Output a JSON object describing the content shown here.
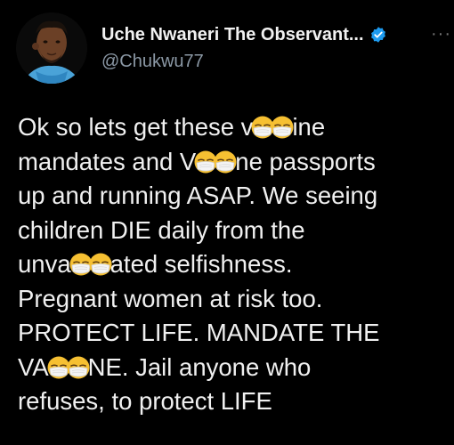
{
  "tweet_header": {
    "display_name": "Uche Nwaneri The Observant...",
    "handle": "@Chukwu77",
    "more_label": "···",
    "verified_icon": "verified-badge-icon",
    "colors": {
      "verified": "#1d9bf0",
      "avatar_ring": "#4aa3d8"
    }
  },
  "tweet_body": {
    "lines": [
      {
        "segments": [
          "Ok so lets get these v",
          "ine"
        ],
        "emojis": [
          "face-with-medical-mask-icon",
          "face-with-medical-mask-icon"
        ]
      },
      {
        "segments": [
          "mandates and V",
          "ne passports"
        ],
        "emojis": [
          "face-with-medical-mask-icon",
          "face-with-medical-mask-icon"
        ]
      },
      {
        "text": "up and running ASAP. We seeing"
      },
      {
        "text": "children DIE daily from the"
      },
      {
        "segments": [
          "unva",
          "ated selfishness."
        ],
        "emojis": [
          "face-with-medical-mask-icon",
          "face-with-medical-mask-icon"
        ]
      },
      {
        "text": "Pregnant women at risk too."
      },
      {
        "text": "PROTECT LIFE. MANDATE THE"
      },
      {
        "segments": [
          "VA",
          "NE. Jail anyone who"
        ],
        "emojis": [
          "face-with-medical-mask-icon",
          "face-with-medical-mask-icon"
        ]
      },
      {
        "text": "refuses, to protect LIFE"
      }
    ]
  }
}
